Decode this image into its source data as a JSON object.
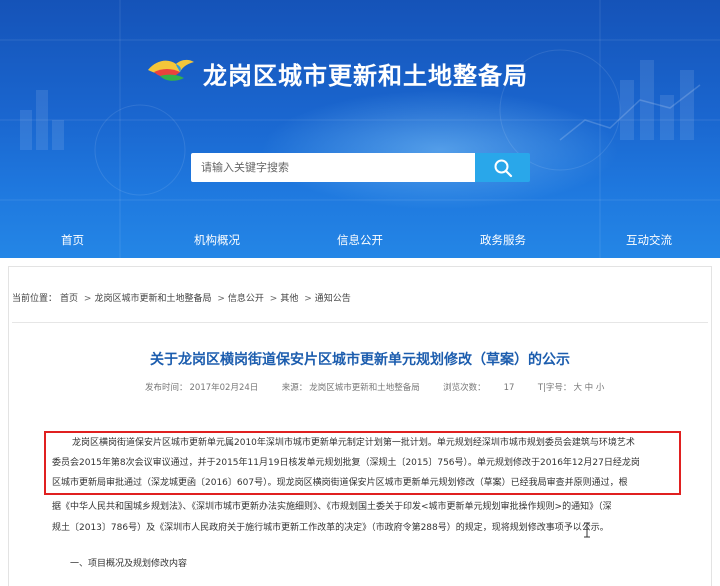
{
  "header": {
    "site_title": "龙岗区城市更新和土地整备局",
    "logo": "dove-logo",
    "search": {
      "placeholder": "请输入关键字搜索",
      "icon": "search-icon"
    },
    "colors": {
      "banner": "#1a66cf",
      "search_button": "#29a7ea"
    }
  },
  "nav": {
    "items": [
      {
        "label": "首页"
      },
      {
        "label": "机构概况"
      },
      {
        "label": "信息公开"
      },
      {
        "label": "政务服务"
      },
      {
        "label": "互动交流"
      }
    ]
  },
  "breadcrumb": {
    "prefix": "当前位置：",
    "items": [
      "首页",
      "龙岗区城市更新和土地整备局",
      "信息公开",
      "其他",
      "通知公告"
    ],
    "separator": ">"
  },
  "article": {
    "title": "关于龙岗区横岗街道保安片区城市更新单元规划修改（草案）的公示",
    "meta": {
      "date_label": "发布时间：",
      "date": "2017年02月24日",
      "source_label": "来源：",
      "source": "龙岗区城市更新和土地整备局",
      "views_label": "浏览次数：",
      "views": "17",
      "fontsize_label": "T|字号：",
      "fontsize_options": "大 中 小"
    },
    "body_lines": [
      "龙岗区横岗街道保安片区城市更新单元属2010年深圳市城市更新单元制定计划第一批计划。单元规划经深圳市城市规划委员会建筑与环境艺术",
      "委员会2015年第8次会议审议通过，并于2015年11月19日核发单元规划批复（深规土〔2015〕756号）。单元规划修改于2016年12月27日经龙岗",
      "区城市更新局审批通过（深龙城更函〔2016〕607号）。现龙岗区横岗街道保安片区城市更新单元规划修改（草案）已经我局审查并原则通过，根",
      "据《中华人民共和国城乡规划法》、《深圳市城市更新办法实施细则》、《市规划国土委关于印发<城市更新单元规划审批操作规则>的通知》（深",
      "规土〔2013〕786号）及《深圳市人民政府关于施行城市更新工作改革的决定》（市政府令第288号）的规定，现将规划修改事项予以公示。"
    ],
    "section_heading": "一、项目概况及规划修改内容"
  }
}
